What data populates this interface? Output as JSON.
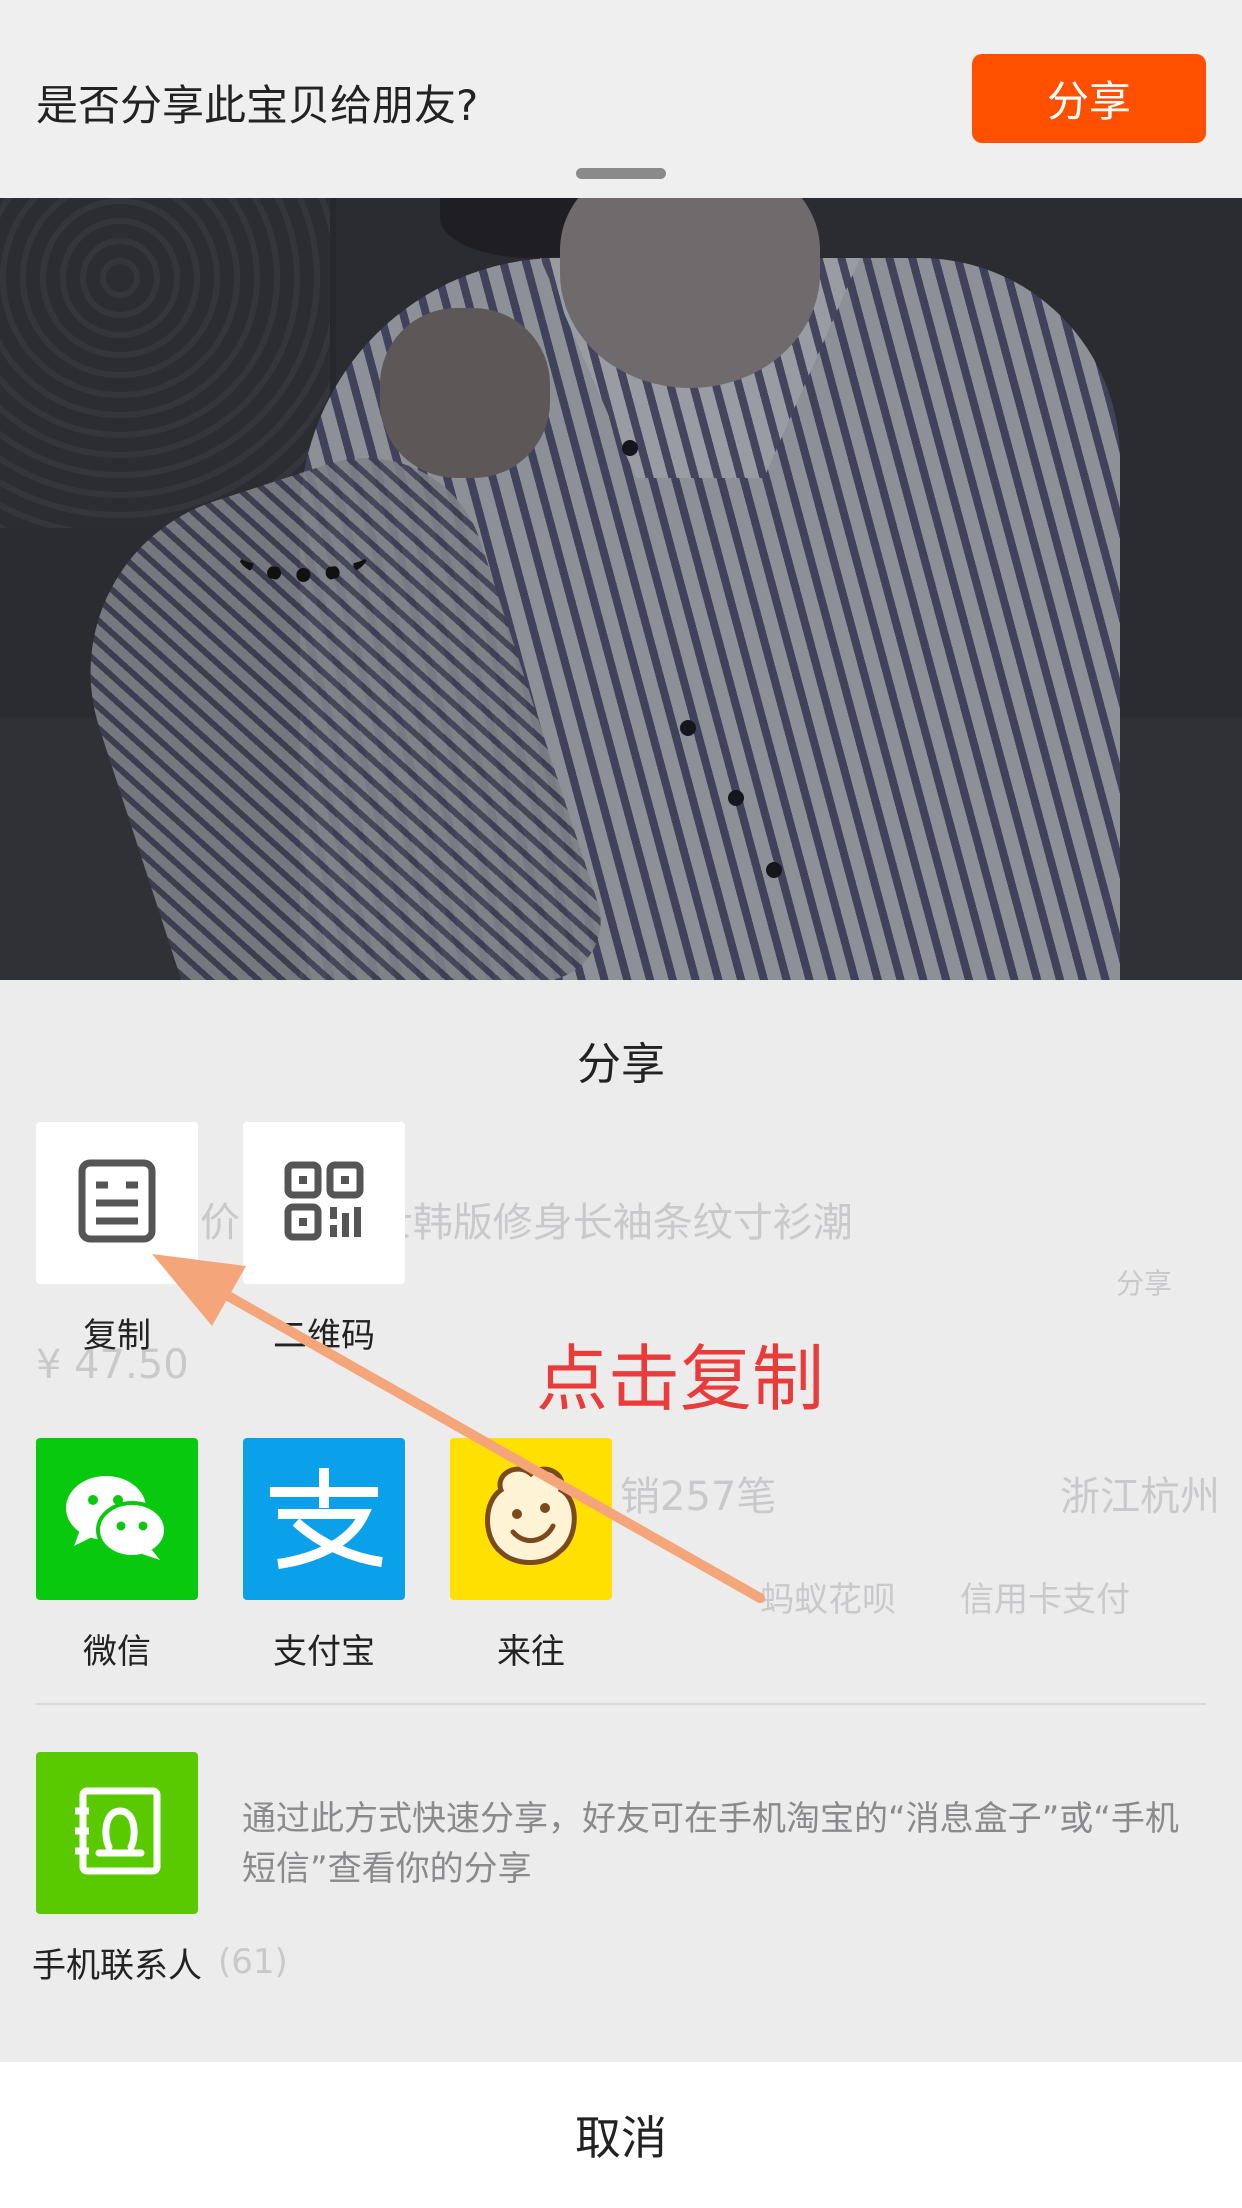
{
  "top_banner": {
    "question": "是否分享此宝贝给朋友?",
    "share_button": "分享"
  },
  "sheet": {
    "title": "分享",
    "row1": [
      {
        "label": "复制",
        "icon": "copy-icon",
        "bg": "#ffffff"
      },
      {
        "label": "二维码",
        "icon": "qrcode-icon",
        "bg": "#ffffff"
      }
    ],
    "row2": [
      {
        "label": "微信",
        "icon": "wechat-icon",
        "bg": "#09c90f"
      },
      {
        "label": "支付宝",
        "icon": "alipay-icon",
        "bg": "#0aa0ea"
      },
      {
        "label": "来往",
        "icon": "laiwang-icon",
        "bg": "#ffe000"
      }
    ],
    "contacts": {
      "label": "手机联系人",
      "icon": "contacts-icon",
      "bg": "#59c900",
      "description": "通过此方式快速分享，好友可在手机淘宝的“消息盒子”或“手机短信”查看你的分享"
    },
    "annotation": "点击复制"
  },
  "background_ghost": {
    "product_title": "价 新款男士韩版修身长袖条纹寸衫潮",
    "share_text": "分享",
    "price": "¥ 47.50",
    "sales": "销257笔",
    "location": "浙江杭州",
    "payment": "信用卡支付",
    "huabei": "蚂蚁花呗",
    "count": "(61)"
  },
  "cancel": "取消",
  "colors": {
    "accent": "#ff5000",
    "annotation": "#ea3b3b",
    "arrow": "#f4a67a"
  }
}
